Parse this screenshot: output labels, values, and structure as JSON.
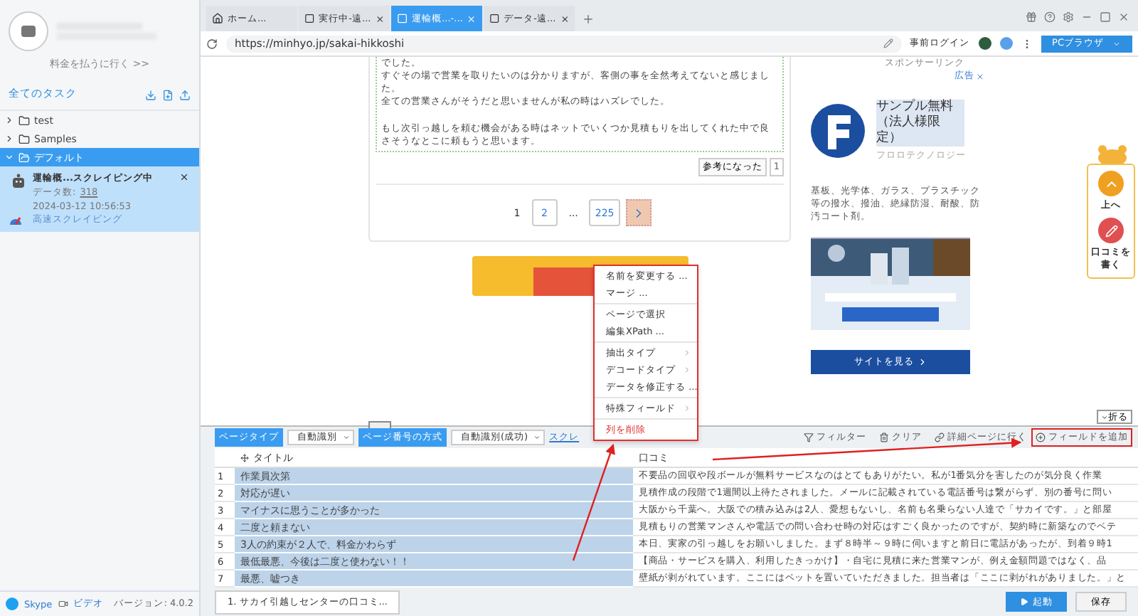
{
  "sidebar": {
    "pay_link": "料金を払うに行く >>",
    "section_title": "全てのタスク",
    "tree": [
      {
        "label": "test",
        "expanded": false,
        "selected": false
      },
      {
        "label": "Samples",
        "expanded": false,
        "selected": false
      },
      {
        "label": "デフォルト",
        "expanded": true,
        "selected": true,
        "children": [
          {
            "name": "運輸概...スクレイピング中",
            "count_label": "データ数:",
            "count": "318",
            "time": "2024-03-12 10:56:53",
            "mode": "高速スクレイピング"
          }
        ]
      }
    ],
    "footer_links": [
      "Skype",
      "ビデオ"
    ],
    "version": "バージョン: 4.0.2"
  },
  "browser": {
    "tabs": [
      {
        "label": "ホーム...",
        "kind": "home",
        "selected": false
      },
      {
        "label": "実行中-遠...",
        "kind": "page",
        "selected": false
      },
      {
        "label": "運輸概...-...",
        "kind": "page",
        "selected": true
      },
      {
        "label": "データ-遠...",
        "kind": "page",
        "selected": false
      }
    ],
    "url": "https://minhyo.jp/sakai-hikkoshi",
    "login_button": "事前ログイン",
    "mode_button": "PCブラウザ"
  },
  "page": {
    "review_paragraphs": [
      [
        "でした。",
        "すぐその場で営業を取りたいのは分かりますが、客側の事を全然考えてないと感じました。",
        "全ての営業さんがそうだと思いませんが私の時はハズレでした。"
      ],
      [
        "もし次引っ越しを頼む機会がある時はネットでいくつか見積もりを出してくれた中で良さそうなとこに頼もうと思います。"
      ]
    ],
    "helpful_button": "参考になった",
    "helpful_count": "1",
    "pagination": [
      {
        "label": "1",
        "kind": "current"
      },
      {
        "label": "2",
        "kind": "link"
      },
      {
        "label": "...",
        "kind": "gap"
      },
      {
        "label": "225",
        "kind": "link"
      },
      {
        "kind": "next"
      }
    ],
    "ad": {
      "sponsor_label": "スポンサーリンク",
      "ad_label": "広告",
      "title": "サンプル無料（法人様限定）",
      "brand": "フロロテクノロジー",
      "description": "基板、光学体、ガラス、プラスチック等の撥水、撥油、絶縁防湿、耐酸、防汚コート剤。",
      "button": "サイトを見る"
    },
    "side_widget": [
      {
        "label": "上へ",
        "kind": "up"
      },
      {
        "label": "口コミを書く",
        "kind": "write"
      }
    ],
    "fold_button": "折る"
  },
  "context_menu": [
    [
      {
        "label": "名前を変更する ...",
        "kind": "action"
      },
      {
        "label": "マージ ...",
        "kind": "action"
      }
    ],
    [
      {
        "label": "ページで選択",
        "kind": "action"
      },
      {
        "label": "編集XPath ...",
        "kind": "action"
      }
    ],
    [
      {
        "label": "抽出タイプ",
        "kind": "submenu"
      },
      {
        "label": "デコードタイプ",
        "kind": "submenu"
      },
      {
        "label": "データを修正する ...",
        "kind": "action"
      }
    ],
    [
      {
        "label": "特殊フィールド",
        "kind": "submenu"
      }
    ],
    [
      {
        "label": "列を削除",
        "kind": "danger"
      }
    ]
  ],
  "extract": {
    "page_type_label": "ページタイプ",
    "page_type": "自動識別",
    "paging_label": "ページ番号の方式",
    "paging": "自動識別(成功)",
    "scroll_link": "スクレ",
    "tools": [
      {
        "label": "フィルター",
        "kind": "filter"
      },
      {
        "label": "クリア",
        "kind": "clear"
      },
      {
        "label": "詳細ページに行く",
        "kind": "link"
      }
    ],
    "add_field": "フィールドを追加",
    "columns": [
      "",
      "タイトル",
      "口コミ"
    ],
    "rows": [
      [
        "1",
        "作業員次第",
        "不要品の回収や段ボールが無料サービスなのはとてもありがたい。私が1番気分を害したのが気分良く作業"
      ],
      [
        "2",
        "対応が遅い",
        "見積作成の段階で1週間以上待たされました。メールに記載されている電話番号は繋がらず、別の番号に問い"
      ],
      [
        "3",
        "マイナスに思うことが多かった",
        "大阪から千葉へ。大阪での積み込みは2人、愛想もないし、名前も名乗らない人達で「サカイです。」と部屋"
      ],
      [
        "4",
        "二度と頼まない",
        "見積もりの営業マンさんや電話での問い合わせ時の対応はすごく良かったのですが、契約時に新築なのでベテ"
      ],
      [
        "5",
        "3人の約束が２人で、料金かわらず",
        "本日、実家の引っ越しをお願いしました。まず８時半～９時に伺いますと前日に電話があったが、到着９時1"
      ],
      [
        "6",
        "最低最悪、今後は二度と使わない！！",
        "【商品・サービスを購入、利用したきっかけ】・自宅に見積に来た営業マンが、例え金額問題ではなく、品"
      ],
      [
        "7",
        "最悪、嘘つき",
        "壁紙が剥がれています。ここにはペットを置いていただきました。担当者は「ここに剥がれがありました。」と"
      ]
    ],
    "task_tab": "1. サカイ引越しセンターの口コミ...",
    "start_button": "起動",
    "save_button": "保存"
  }
}
